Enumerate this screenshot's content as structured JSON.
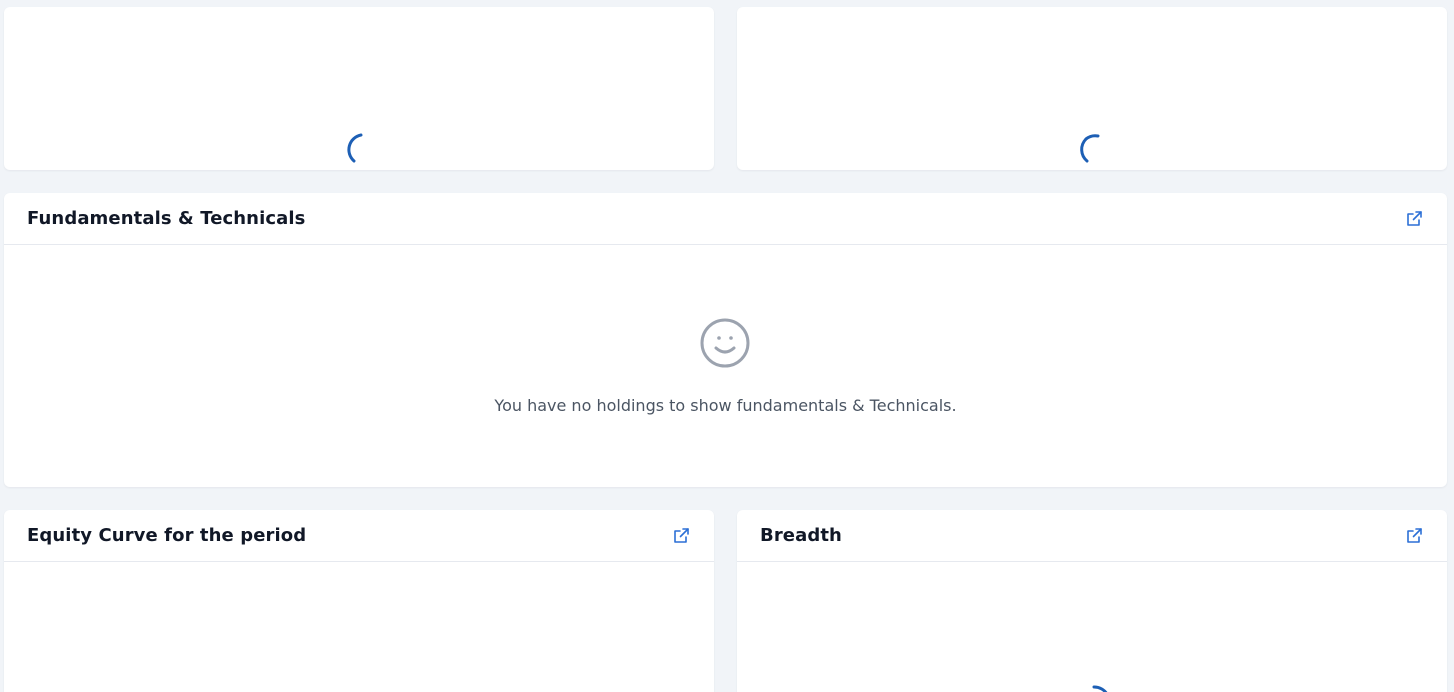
{
  "colors": {
    "background": "#f1f4f8",
    "card": "#ffffff",
    "accent": "#2b6fd6",
    "spinner": "#1d5fb5",
    "empty_icon": "#9ca3af"
  },
  "cards": {
    "top_left": {
      "loading": true
    },
    "top_right": {
      "loading": true
    },
    "fundamentals": {
      "title": "Fundamentals & Technicals",
      "empty_icon": "smiley-face-icon",
      "empty_message": "You have no holdings to show fundamentals & Technicals."
    },
    "equity_curve": {
      "title": "Equity Curve for the period"
    },
    "breadth": {
      "title": "Breadth",
      "loading": true
    }
  }
}
